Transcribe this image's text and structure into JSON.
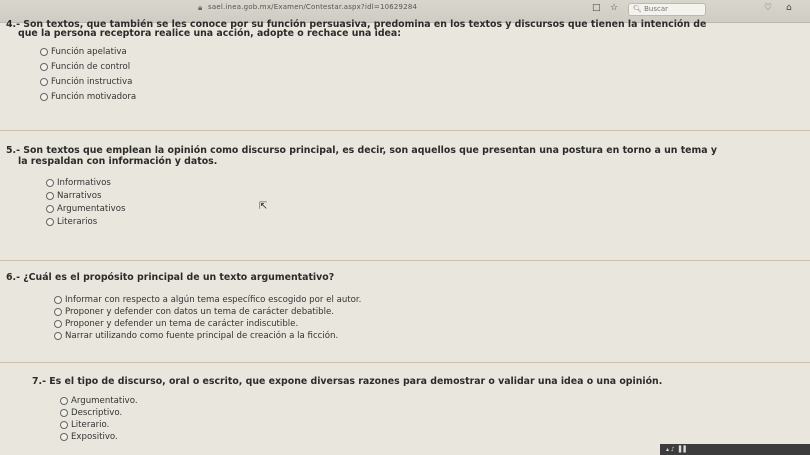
{
  "browser": {
    "url": "sael.inea.gob.mx/Examen/Contestar.aspx?idl=10629284",
    "search_placeholder": "Buscar"
  },
  "questions": [
    {
      "line1": "4.- Son textos, que también se les conoce por su función persuasiva, predomina en los textos y discursos que tienen la intención de",
      "line2": "que la persona receptora realice una acción, adopte o rechace una idea:",
      "options": [
        "Función apelativa",
        "Función de control",
        "Función instructiva",
        "Función motivadora"
      ]
    },
    {
      "line1": "5.- Son textos que emplean la opinión como discurso principal, es decir, son aquellos que presentan una postura en torno a un tema y",
      "line2": "la respaldan con información y datos.",
      "options": [
        "Informativos",
        "Narrativos",
        "Argumentativos",
        "Literarios"
      ]
    },
    {
      "line1": "6.- ¿Cuál es el propósito principal de un texto argumentativo?",
      "line2": "",
      "options": [
        "Informar con respecto a algún tema específico escogido por el autor.",
        "Proponer y defender con datos un tema de carácter debatible.",
        "Proponer y defender un tema de carácter indiscutible.",
        "Narrar utilizando como fuente principal de creación a la ficción."
      ]
    },
    {
      "line1": "7.- Es el tipo de discurso, oral o escrito, que expone diversas razones para demostrar o validar una idea o una opinión.",
      "line2": "",
      "options": [
        "Argumentativo.",
        "Descriptivo.",
        "Literario.",
        "Expositivo."
      ]
    }
  ]
}
